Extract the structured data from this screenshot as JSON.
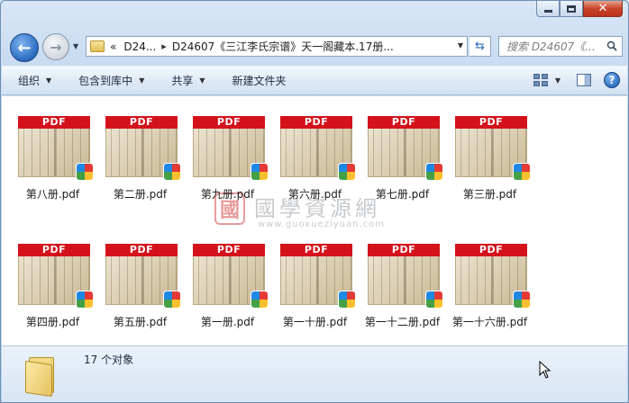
{
  "window": {
    "caption": {
      "minimize": "–",
      "maximize": "□",
      "close": "✕"
    }
  },
  "navigation": {
    "back_icon": "back-arrow-icon",
    "forward_icon": "forward-arrow-icon"
  },
  "address_bar": {
    "overflow": "«",
    "crumbs": [
      "D24...",
      "D24607《三江李氏宗谱》天一阁藏本.17册..."
    ]
  },
  "search": {
    "placeholder": "搜索 D24607《...",
    "icon": "search-icon"
  },
  "toolbar": {
    "organize": "组织",
    "include_in_library": "包含到库中",
    "share": "共享",
    "new_folder": "新建文件夹"
  },
  "files": [
    {
      "name": "第八册.pdf"
    },
    {
      "name": "第二册.pdf"
    },
    {
      "name": "第九册.pdf"
    },
    {
      "name": "第六册.pdf"
    },
    {
      "name": "第七册.pdf"
    },
    {
      "name": "第三册.pdf"
    },
    {
      "name": "第四册.pdf"
    },
    {
      "name": "第五册.pdf"
    },
    {
      "name": "第一册.pdf"
    },
    {
      "name": "第一十册.pdf"
    },
    {
      "name": "第一十二册.pdf"
    },
    {
      "name": "第一十六册.pdf"
    }
  ],
  "thumbnail_banner": "PDF",
  "watermark": {
    "seal": "國",
    "title": "國學資源網",
    "url": "www.guoxueziyuan.com"
  },
  "status": {
    "item_count": "17 个对象"
  },
  "colors": {
    "pdf_banner": "#d4121c",
    "accent_blue": "#2a6cc2"
  }
}
